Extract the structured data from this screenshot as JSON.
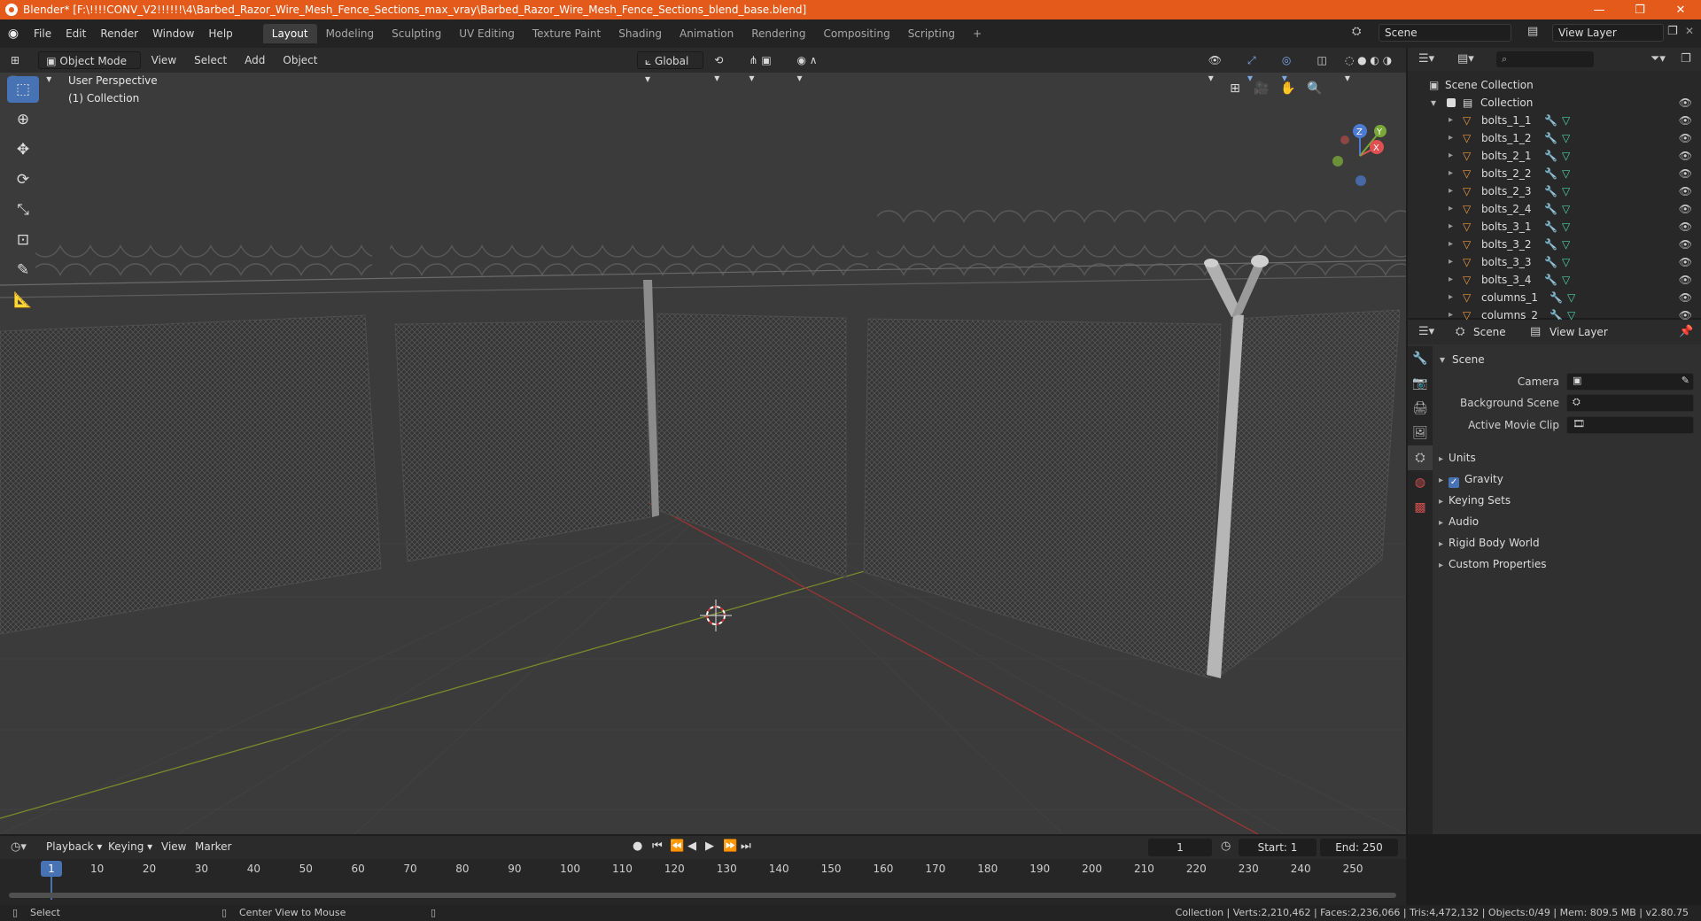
{
  "titlebar": {
    "title": "Blender* [F:\\!!!!CONV_V2!!!!!!\\4\\Barbed_Razor_Wire_Mesh_Fence_Sections_max_vray\\Barbed_Razor_Wire_Mesh_Fence_Sections_blend_base.blend]",
    "minimize": "—",
    "restore": "❐",
    "close": "✕"
  },
  "menu": [
    "File",
    "Edit",
    "Render",
    "Window",
    "Help"
  ],
  "workspaces": [
    "Layout",
    "Modeling",
    "Sculpting",
    "UV Editing",
    "Texture Paint",
    "Shading",
    "Animation",
    "Rendering",
    "Compositing",
    "Scripting"
  ],
  "add_workspace": "+",
  "scene_name": "Scene",
  "view_layer": "View Layer",
  "viewport": {
    "mode": "Object Mode",
    "menus": [
      "View",
      "Select",
      "Add",
      "Object"
    ],
    "transform": "Global",
    "perspective": "User Perspective",
    "collection": "(1) Collection",
    "gizmo": {
      "z": "Z",
      "y": "Y",
      "x": "X"
    }
  },
  "outliner": {
    "root": "Scene Collection",
    "collection": "Collection",
    "items": [
      "bolts_1_1",
      "bolts_1_2",
      "bolts_2_1",
      "bolts_2_2",
      "bolts_2_3",
      "bolts_2_4",
      "bolts_3_1",
      "bolts_3_2",
      "bolts_3_3",
      "bolts_3_4",
      "columns_1",
      "columns_2"
    ]
  },
  "properties": {
    "tab_scene": "Scene",
    "tab_view_layer": "View Layer",
    "panel": "Scene",
    "camera_label": "Camera",
    "bg_scene_label": "Background Scene",
    "movie_clip_label": "Active Movie Clip",
    "sections": [
      "Units",
      "Gravity",
      "Keying Sets",
      "Audio",
      "Rigid Body World",
      "Custom Properties"
    ]
  },
  "timeline": {
    "menus": [
      "Playback",
      "Keying",
      "View",
      "Marker"
    ],
    "current_frame": "1",
    "start_label": "Start:",
    "start": "1",
    "end_label": "End:",
    "end": "250",
    "ticks": [
      "10",
      "20",
      "30",
      "40",
      "50",
      "60",
      "70",
      "80",
      "90",
      "100",
      "110",
      "120",
      "130",
      "140",
      "150",
      "160",
      "170",
      "180",
      "190",
      "200",
      "210",
      "220",
      "230",
      "240",
      "250"
    ],
    "marker": "1"
  },
  "statusbar": {
    "left1": "Select",
    "left2": "Center View to Mouse",
    "stats": "Collection | Verts:2,210,462 | Faces:2,236,066 | Tris:4,472,132 | Objects:0/49 | Mem: 809.5 MB | v2.80.75"
  }
}
